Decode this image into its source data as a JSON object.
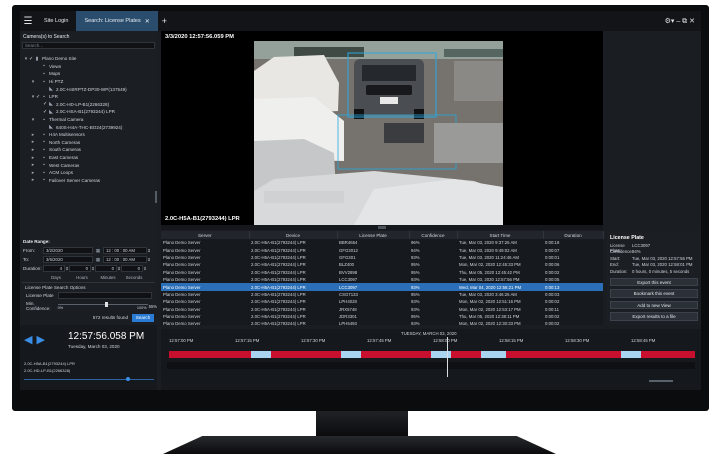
{
  "titlebar": {
    "tabs": [
      {
        "label": "Site Login",
        "active": false
      },
      {
        "label": "Search: License Plates",
        "active": true
      }
    ],
    "add_tab": "+",
    "window_controls": "⚙▾ – ⧉ ✕"
  },
  "left": {
    "section_title": "Camera(s) to Search",
    "search_placeholder": "Search...",
    "tree": [
      {
        "label": "Plano Demo Site",
        "icon": "site-icon",
        "level": 0,
        "expander": "▾",
        "checked": true
      },
      {
        "label": "Views",
        "icon": "folder-icon",
        "level": 1,
        "expander": "",
        "checked": false
      },
      {
        "label": "Maps",
        "icon": "folder-icon",
        "level": 1,
        "expander": "",
        "checked": false
      },
      {
        "label": "Hi PTZ",
        "icon": "folder-icon",
        "level": 1,
        "expander": "▾",
        "checked": false
      },
      {
        "label": "2.0C-H4IRPTZ-DP30-WP(137549)",
        "icon": "camera-icon",
        "level": 2,
        "expander": "",
        "checked": false
      },
      {
        "label": "LPR",
        "icon": "folder-icon",
        "level": 1,
        "expander": "▾",
        "checked": true
      },
      {
        "label": "2.0C-HD-LP-B1(2266328)",
        "icon": "camera-icon",
        "level": 2,
        "expander": "",
        "checked": true
      },
      {
        "label": "2.0C-HSA-B1(2793244) LPR",
        "icon": "camera-icon",
        "level": 2,
        "expander": "",
        "checked": true
      },
      {
        "label": "Thermal Camera",
        "icon": "folder-icon",
        "level": 1,
        "expander": "▾",
        "checked": false
      },
      {
        "label": "640S-H4A-THC-BO24(2739924)",
        "icon": "camera-icon",
        "level": 2,
        "expander": "",
        "checked": false
      },
      {
        "label": "H4A Multisensors",
        "icon": "folder-icon",
        "level": 1,
        "expander": "▸",
        "checked": false
      },
      {
        "label": "North Cameras",
        "icon": "folder-icon",
        "level": 1,
        "expander": "▸",
        "checked": false
      },
      {
        "label": "South Cameras",
        "icon": "folder-icon",
        "level": 1,
        "expander": "▸",
        "checked": false
      },
      {
        "label": "East Cameras",
        "icon": "folder-icon",
        "level": 1,
        "expander": "▸",
        "checked": false
      },
      {
        "label": "West Cameras",
        "icon": "folder-icon",
        "level": 1,
        "expander": "▸",
        "checked": false
      },
      {
        "label": "ACM Loops",
        "icon": "folder-icon",
        "level": 1,
        "expander": "▸",
        "checked": false
      },
      {
        "label": "Failover Server Cameras",
        "icon": "folder-icon",
        "level": 1,
        "expander": "▸",
        "checked": false
      }
    ],
    "date_range": {
      "title": "Date Range:",
      "from_label": "From:",
      "from_date": "3/2/2020",
      "from_time": "12 : 00 : 00 AM",
      "to_label": "To:",
      "to_date": "3/6/2020",
      "to_time": "12 : 00 : 00 AM",
      "duration_label": "Duration:",
      "duration_values": [
        "4",
        "0",
        "0",
        "0"
      ],
      "duration_units": [
        "Days",
        "Hours",
        "Minutes",
        "Seconds"
      ]
    },
    "lp_options": {
      "title": "License Plate Search Options",
      "plate_label": "License Plate",
      "confidence_label": "Min. Confidence:",
      "confidence_value": "55%",
      "confidence_min": "0%",
      "confidence_max": "100%",
      "confidence_level": 0.55,
      "results_found": "572 results found",
      "search_button": "Search"
    }
  },
  "video": {
    "timestamp": "3/3/2020 12:57:56.059 PM",
    "camera_name": "2.0C-H5A-B1(2793244) LPR"
  },
  "results": {
    "columns": [
      "Server",
      "Device",
      "License Plate",
      "Confidence",
      "Start Time",
      "Duration"
    ],
    "selected_index": 6,
    "rows": [
      [
        "Plano Demo Server",
        "2.0C-H5A-B1(2793244) LPR",
        "BBR4654",
        "96%",
        "Tue, Mar 03, 2020 9:37:26 AM",
        "0:00:18"
      ],
      [
        "Plano Demo Server",
        "2.0C-H5A-B1(2793244) LPR",
        "GFG3012",
        "94%",
        "Tue, Mar 03, 2020 9:49:02 AM",
        "0:00:07"
      ],
      [
        "Plano Demo Server",
        "2.0C-H5A-B1(2793244) LPR",
        "GFG301",
        "93%",
        "Tue, Mar 03, 2020 11:24:46 AM",
        "0:00:01"
      ],
      [
        "Plano Demo Server",
        "2.0C-H5A-B1(2793244) LPR",
        "BLZ400",
        "95%",
        "Mon, Mar 02, 2020 12:45:33 PM",
        "0:00:06"
      ],
      [
        "Plano Demo Server",
        "2.0C-H5A-B1(2793244) LPR",
        "BVV2898",
        "95%",
        "Thu, Mar 05, 2020 12:45:42 PM",
        "0:00:02"
      ],
      [
        "Plano Demo Server",
        "2.0C-H5A-B1(2793244) LPR",
        "LCC3097",
        "93%",
        "Tue, Mar 03, 2020 12:57:56 PM",
        "0:00:05"
      ],
      [
        "Plano Demo Server",
        "2.0C-H5A-B1(2793244) LPR",
        "LCC3097",
        "93%",
        "Wed, Mar 04, 2020 12:56:21 PM",
        "0:00:13"
      ],
      [
        "Plano Demo Server",
        "2.0C-H5A-B1(2793244) LPR",
        "CSG7133",
        "95%",
        "Tue, Mar 03, 2020 3:46:26 AM",
        "0:00:03"
      ],
      [
        "Plano Demo Server",
        "2.0C-H5A-B1(2793244) LPR",
        "LPH4028",
        "93%",
        "Mon, Mar 02, 2020 12:51:16 PM",
        "0:00:02"
      ],
      [
        "Plano Demo Server",
        "2.0C-H5A-B1(2793244) LPR",
        "JRX5748",
        "93%",
        "Mon, Mar 02, 2020 12:53:17 PM",
        "0:00:11"
      ],
      [
        "Plano Demo Server",
        "2.0C-H5A-B1(2793244) LPR",
        "JDR3301",
        "95%",
        "Thu, Mar 05, 2020 12:38:11 PM",
        "0:00:02"
      ],
      [
        "Plano Demo Server",
        "2.0C-H5A-B1(2793244) LPR",
        "LPH5493",
        "93%",
        "Mon, Mar 02, 2020 12:30:33 PM",
        "0:00:02"
      ]
    ]
  },
  "details": {
    "title": "License Plate",
    "fields": [
      {
        "key": "License Plate:",
        "value": "LCC3097"
      },
      {
        "key": "Confidence:",
        "value": "94%"
      },
      {
        "key": "Start:",
        "value": "Tue, Mar 03, 2020 12:57:56 PM"
      },
      {
        "key": "End:",
        "value": "Tue, Mar 03, 2020 12:58:01 PM"
      },
      {
        "key": "Duration:",
        "value": "0 hours, 0 minutes, 5 seconds"
      }
    ],
    "buttons": [
      "Export this event",
      "Bookmark this event",
      "Add to new View",
      "Export results to a file"
    ]
  },
  "playback": {
    "time": "12:57:56.058 PM",
    "date": "Tuesday, March 03, 2020",
    "cameras": [
      "2.0C-H5A-B1(2793244) LPR",
      "2.0C-HD-LP-B1(2266328)"
    ],
    "position": 0.8
  },
  "timeline": {
    "date": "TUESDAY, MARCH 03, 2020",
    "ticks": [
      "12:57:00 PM",
      "12:57:15 PM",
      "12:57:30 PM",
      "12:57:45 PM",
      "12:58:00 PM",
      "12:58:15 PM",
      "12:58:30 PM",
      "12:58:45 PM"
    ],
    "colors": {
      "recorded": "#c8102e",
      "motion": "#a8d4f0"
    }
  },
  "colors": {
    "accent": "#2a7bd4",
    "selected_row": "#2a6fb8",
    "bbox": "#29a8e0"
  }
}
